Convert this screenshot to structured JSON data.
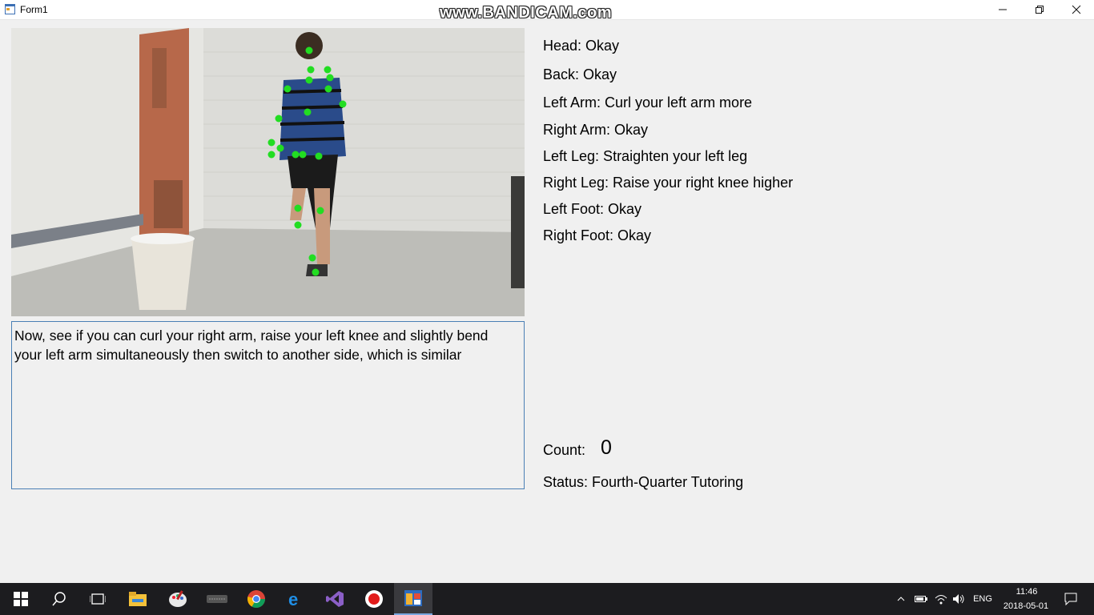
{
  "window": {
    "title": "Form1",
    "watermark": "www.BANDICAM.com"
  },
  "feedback": [
    {
      "part": "Head",
      "label": "Head: Okay"
    },
    {
      "part": "Back",
      "label": "Back: Okay"
    },
    {
      "part": "Left Arm",
      "label": "Left Arm: Curl your left arm more"
    },
    {
      "part": "Right Arm",
      "label": "Right Arm: Okay"
    },
    {
      "part": "Left Leg",
      "label": "Left Leg: Straighten your left leg"
    },
    {
      "part": "Right Leg",
      "label": "Right Leg: Raise your right knee higher"
    },
    {
      "part": "Left Foot",
      "label": "Left Foot: Okay"
    },
    {
      "part": "Right Foot",
      "label": "Right Foot: Okay"
    }
  ],
  "instruction": "Now, see if you can curl your right arm, raise your left knee and slightly bend your left arm simultaneously then switch to another side, which is similar",
  "count": {
    "label": "Count:",
    "value": "0"
  },
  "status": "Status: Fourth-Quarter Tutoring",
  "skeleton": {
    "joint_color": "#22dd22"
  },
  "taskbar": {
    "apps": [
      "windows-start",
      "search",
      "task-view",
      "file-explorer",
      "paint",
      "keyboard",
      "chrome",
      "edge",
      "visual-studio",
      "bandicam-record",
      "form-app"
    ],
    "language": "ENG",
    "time": "11:46",
    "date": "2018-05-01"
  }
}
